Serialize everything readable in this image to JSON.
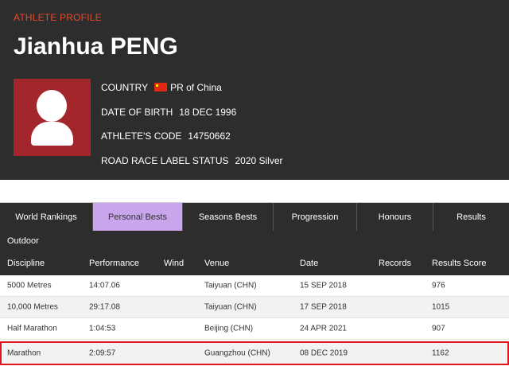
{
  "profile": {
    "eyebrow": "ATHLETE PROFILE",
    "name": "Jianhua PENG",
    "country_label": "COUNTRY",
    "country_value": "PR of China",
    "dob_label": "DATE OF BIRTH",
    "dob_value": "18 DEC 1996",
    "code_label": "ATHLETE'S CODE",
    "code_value": "14750662",
    "road_label": "ROAD RACE LABEL STATUS",
    "road_value": "2020 Silver",
    "flag_icon": "china-flag-icon",
    "accent_color": "#e8472b"
  },
  "tabs": [
    {
      "label": "World Rankings",
      "active": false
    },
    {
      "label": "Personal Bests",
      "active": true
    },
    {
      "label": "Seasons Bests",
      "active": false
    },
    {
      "label": "Progression",
      "active": false
    },
    {
      "label": "Honours",
      "active": false
    },
    {
      "label": "Results",
      "active": false
    }
  ],
  "section": "Outdoor",
  "table": {
    "headers": [
      "Discipline",
      "Performance",
      "Wind",
      "Venue",
      "Date",
      "Records",
      "Results Score"
    ],
    "rows": [
      {
        "discipline": "5000 Metres",
        "performance": "14:07.06",
        "wind": "",
        "venue": "Taiyuan (CHN)",
        "date": "15 SEP 2018",
        "records": "",
        "score": "976"
      },
      {
        "discipline": "10,000 Metres",
        "performance": "29:17.08",
        "wind": "",
        "venue": "Taiyuan (CHN)",
        "date": "17 SEP 2018",
        "records": "",
        "score": "1015"
      },
      {
        "discipline": "Half Marathon",
        "performance": "1:04:53",
        "wind": "",
        "venue": "Beijing (CHN)",
        "date": "24 APR 2021",
        "records": "",
        "score": "907"
      },
      {
        "discipline": "Marathon",
        "performance": "2:09:57",
        "wind": "",
        "venue": "Guangzhou (CHN)",
        "date": "08 DEC 2019",
        "records": "",
        "score": "1162"
      }
    ]
  },
  "colors": {
    "active_tab": "#c9a6ec",
    "highlight_border": "#e0161e",
    "header_bg": "#2d2d2d"
  }
}
